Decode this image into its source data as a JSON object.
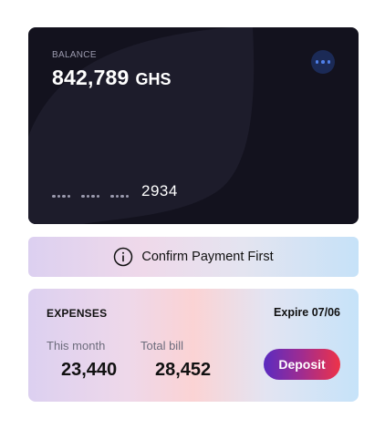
{
  "balance_card": {
    "label": "BALANCE",
    "amount": "842,789",
    "currency": "GHS",
    "masked_groups": [
      "••••",
      "••••",
      "••••"
    ],
    "last4": "2934",
    "more_icon": "more-horizontal-icon"
  },
  "confirm_banner": {
    "icon": "info-circle-icon",
    "label": "Confirm Payment First"
  },
  "expenses": {
    "title": "EXPENSES",
    "expire": "Expire 07/06",
    "this_month_label": "This month",
    "this_month_value": "23,440",
    "total_bill_label": "Total bill",
    "total_bill_value": "28,452",
    "deposit_label": "Deposit"
  },
  "colors": {
    "card_bg": "#13121e",
    "more_button_bg": "#1b2a56",
    "more_button_dots": "#4f7fe8",
    "deposit_gradient_start": "#5a2bc0",
    "deposit_gradient_end": "#ee3348"
  }
}
